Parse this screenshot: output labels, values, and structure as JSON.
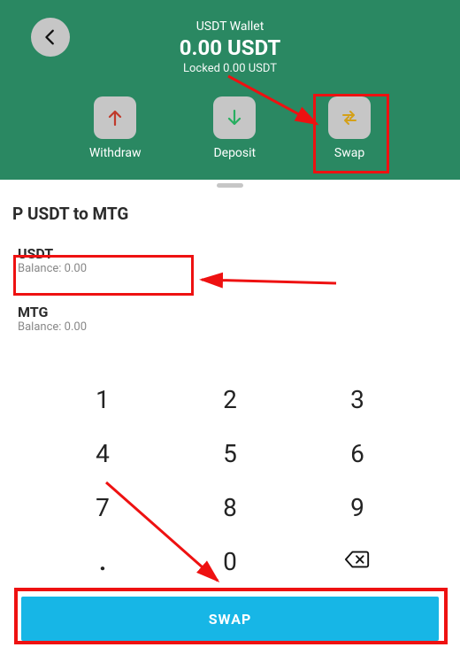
{
  "header": {
    "wallet_label": "USDT Wallet",
    "wallet_amount": "0.00 USDT",
    "wallet_locked": "Locked 0.00 USDT"
  },
  "actions": {
    "withdraw": "Withdraw",
    "deposit": "Deposit",
    "swap": "Swap"
  },
  "swap": {
    "title": "P USDT to MTG",
    "from": {
      "currency": "USDT",
      "balance": "Balance: 0.00"
    },
    "to": {
      "currency": "MTG",
      "balance": "Balance: 0.00"
    },
    "button_label": "SWAP"
  },
  "keypad": {
    "k1": "1",
    "k2": "2",
    "k3": "3",
    "k4": "4",
    "k5": "5",
    "k6": "6",
    "k7": "7",
    "k8": "8",
    "k9": "9",
    "k0": "0",
    "dot": "."
  },
  "colors": {
    "header_bg": "#2a8862",
    "swap_btn": "#17b6e6",
    "annotation": "#e11"
  }
}
